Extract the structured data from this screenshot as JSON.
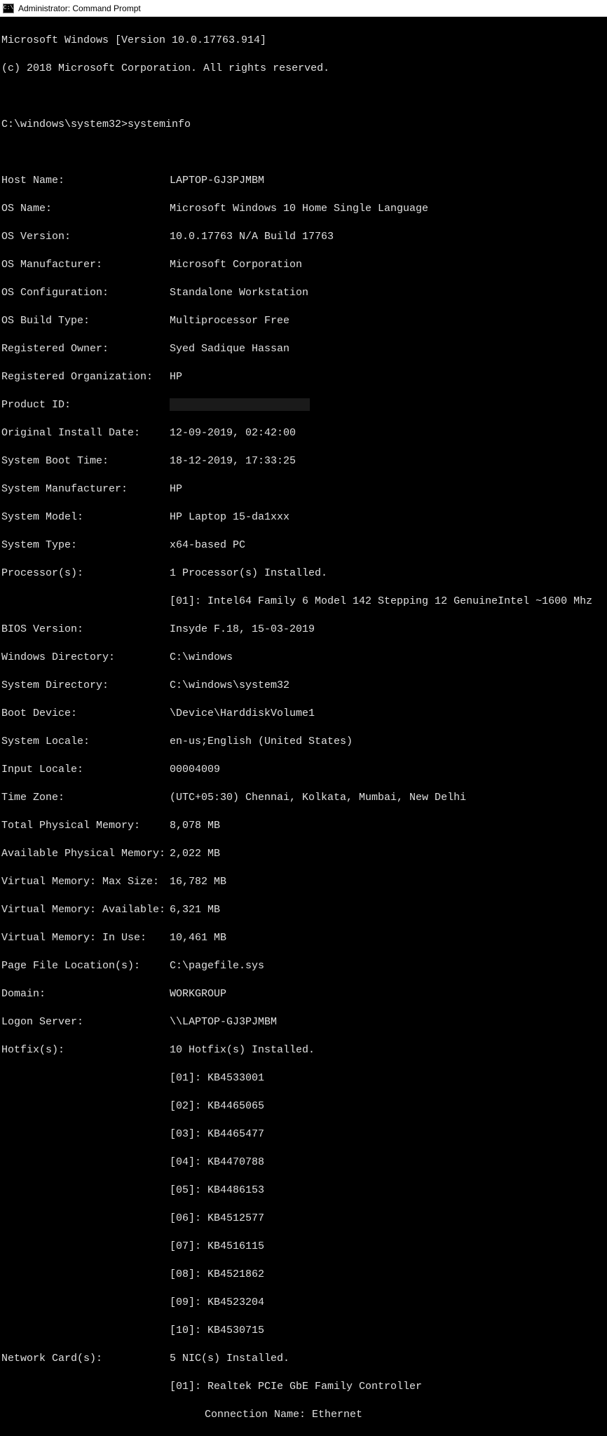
{
  "titlebar": {
    "icon_text": "C:\\",
    "title": "Administrator: Command Prompt"
  },
  "header": {
    "line1": "Microsoft Windows [Version 10.0.17763.914]",
    "line2": "(c) 2018 Microsoft Corporation. All rights reserved."
  },
  "prompt": {
    "path": "C:\\windows\\system32>",
    "command": "systeminfo"
  },
  "info": {
    "host_name_label": "Host Name:",
    "host_name_value": "LAPTOP-GJ3PJMBM",
    "os_name_label": "OS Name:",
    "os_name_value": "Microsoft Windows 10 Home Single Language",
    "os_version_label": "OS Version:",
    "os_version_value": "10.0.17763 N/A Build 17763",
    "os_manufacturer_label": "OS Manufacturer:",
    "os_manufacturer_value": "Microsoft Corporation",
    "os_config_label": "OS Configuration:",
    "os_config_value": "Standalone Workstation",
    "os_build_type_label": "OS Build Type:",
    "os_build_type_value": "Multiprocessor Free",
    "registered_owner_label": "Registered Owner:",
    "registered_owner_value": "Syed Sadique Hassan",
    "registered_org_label": "Registered Organization:",
    "registered_org_value": "HP",
    "product_id_label": "Product ID:",
    "install_date_label": "Original Install Date:",
    "install_date_value": "12-09-2019, 02:42:00",
    "boot_time_label": "System Boot Time:",
    "boot_time_value": "18-12-2019, 17:33:25",
    "sys_manufacturer_label": "System Manufacturer:",
    "sys_manufacturer_value": "HP",
    "sys_model_label": "System Model:",
    "sys_model_value": "HP Laptop 15-da1xxx",
    "sys_type_label": "System Type:",
    "sys_type_value": "x64-based PC",
    "processors_label": "Processor(s):",
    "processors_value": "1 Processor(s) Installed.",
    "processor_detail": "[01]: Intel64 Family 6 Model 142 Stepping 12 GenuineIntel ~1600 Mhz",
    "bios_label": "BIOS Version:",
    "bios_value": "Insyde F.18, 15-03-2019",
    "win_dir_label": "Windows Directory:",
    "win_dir_value": "C:\\windows",
    "sys_dir_label": "System Directory:",
    "sys_dir_value": "C:\\windows\\system32",
    "boot_device_label": "Boot Device:",
    "boot_device_value": "\\Device\\HarddiskVolume1",
    "sys_locale_label": "System Locale:",
    "sys_locale_value": "en-us;English (United States)",
    "input_locale_label": "Input Locale:",
    "input_locale_value": "00004009",
    "timezone_label": "Time Zone:",
    "timezone_value": "(UTC+05:30) Chennai, Kolkata, Mumbai, New Delhi",
    "total_mem_label": "Total Physical Memory:",
    "total_mem_value": "8,078 MB",
    "avail_mem_label": "Available Physical Memory:",
    "avail_mem_value": "2,022 MB",
    "vmem_max_label": "Virtual Memory: Max Size:",
    "vmem_max_value": "16,782 MB",
    "vmem_avail_label": "Virtual Memory: Available:",
    "vmem_avail_value": "6,321 MB",
    "vmem_inuse_label": "Virtual Memory: In Use:",
    "vmem_inuse_value": "10,461 MB",
    "pagefile_label": "Page File Location(s):",
    "pagefile_value": "C:\\pagefile.sys",
    "domain_label": "Domain:",
    "domain_value": "WORKGROUP",
    "logon_server_label": "Logon Server:",
    "logon_server_value": "\\\\LAPTOP-GJ3PJMBM",
    "hotfix_label": "Hotfix(s):",
    "hotfix_value": "10 Hotfix(s) Installed.",
    "hotfixes": [
      "[01]: KB4533001",
      "[02]: KB4465065",
      "[03]: KB4465477",
      "[04]: KB4470788",
      "[05]: KB4486153",
      "[06]: KB4512577",
      "[07]: KB4516115",
      "[08]: KB4521862",
      "[09]: KB4523204",
      "[10]: KB4530715"
    ],
    "netcard_label": "Network Card(s):",
    "netcard_value": "5 NIC(s) Installed.",
    "netcard_detail1": "[01]: Realtek PCIe GbE Family Controller",
    "netcard_detail2": "Connection Name: Ethernet"
  }
}
